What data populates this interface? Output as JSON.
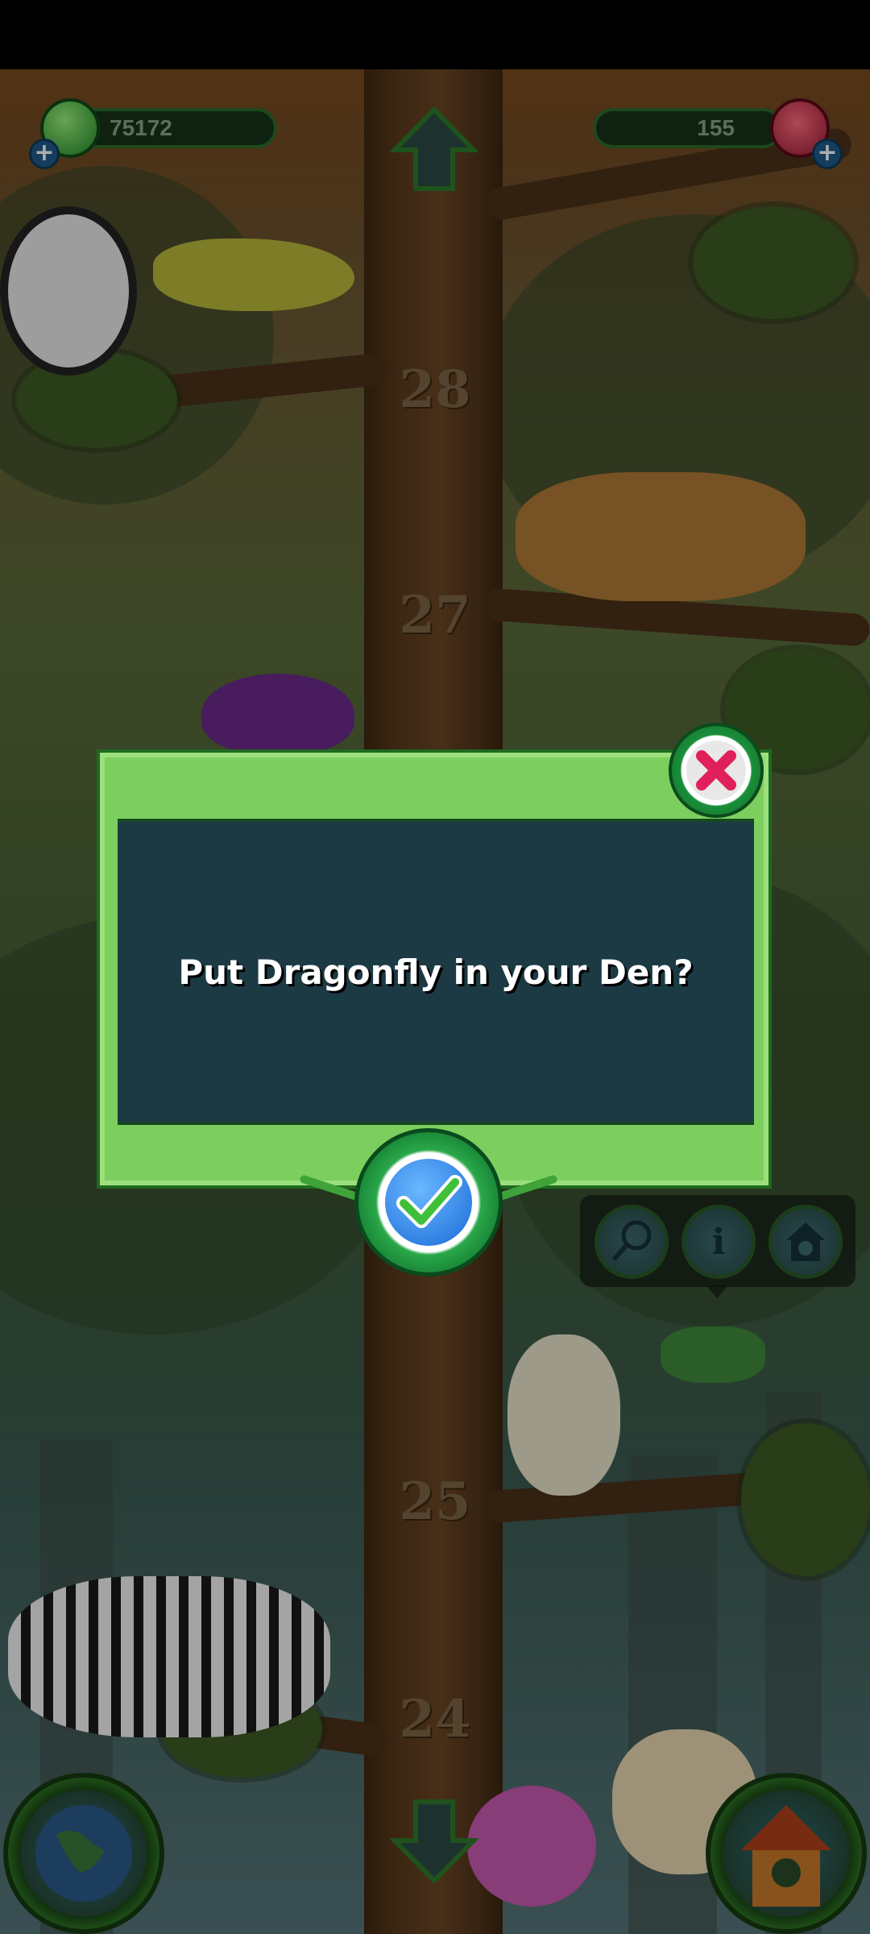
{
  "hud": {
    "coins": "75172",
    "gems": "155",
    "coins_plus": "+",
    "gems_plus": "+"
  },
  "tree": {
    "floors": [
      "28",
      "27",
      "25",
      "24"
    ]
  },
  "dialog": {
    "message": "Put Dragonfly in your Den?"
  },
  "action_tray": {
    "items": [
      {
        "icon": "net-icon"
      },
      {
        "icon": "info-icon",
        "label": "i"
      },
      {
        "icon": "den-icon"
      }
    ]
  },
  "colors": {
    "dialog_frame": "#7ccf5e",
    "dialog_panel": "#1c3a44",
    "confirm": "#1a6ad8",
    "close": "#e0205a"
  }
}
